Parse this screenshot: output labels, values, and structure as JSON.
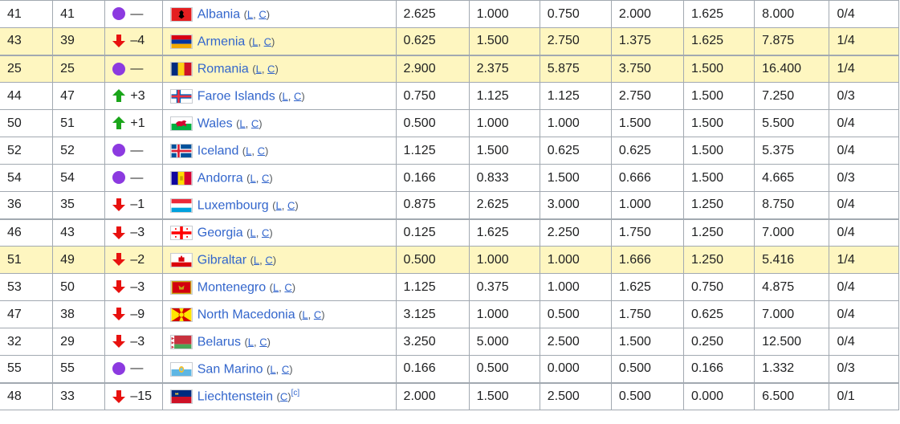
{
  "colors": {
    "highlight_row": "#fef6c0",
    "link": "#3366cc",
    "border": "#a2a9b1",
    "up": "#1aa51a",
    "down": "#e8110f",
    "steady": "#8c3ae0"
  },
  "rows": [
    {
      "a": "41",
      "b": "41",
      "move": "steady",
      "change": "—",
      "flag": "albania-flag-icon",
      "country": "Albania",
      "lc_open": "(",
      "l": "L",
      "comma": ", ",
      "c": "C",
      "lc_close": ")",
      "note": "",
      "v1": "2.625",
      "v2": "1.000",
      "v3": "0.750",
      "v4": "2.000",
      "v5": "1.625",
      "tot": "8.000",
      "frac": "0/4",
      "hl": false,
      "sep": false
    },
    {
      "a": "43",
      "b": "39",
      "move": "down",
      "change": "–4",
      "flag": "armenia-flag-icon",
      "country": "Armenia",
      "lc_open": "(",
      "l": "L",
      "comma": ", ",
      "c": "C",
      "lc_close": ")",
      "note": "",
      "v1": "0.625",
      "v2": "1.500",
      "v3": "2.750",
      "v4": "1.375",
      "v5": "1.625",
      "tot": "7.875",
      "frac": "1/4",
      "hl": true,
      "sep": false
    },
    {
      "a": "25",
      "b": "25",
      "move": "steady",
      "change": "—",
      "flag": "romania-flag-icon",
      "country": "Romania",
      "lc_open": "(",
      "l": "L",
      "comma": ", ",
      "c": "C",
      "lc_close": ")",
      "note": "",
      "v1": "2.900",
      "v2": "2.375",
      "v3": "5.875",
      "v4": "3.750",
      "v5": "1.500",
      "tot": "16.400",
      "frac": "1/4",
      "hl": true,
      "sep": true
    },
    {
      "a": "44",
      "b": "47",
      "move": "up",
      "change": "+3",
      "flag": "faroe-islands-flag-icon",
      "country": "Faroe Islands",
      "lc_open": "(",
      "l": "L",
      "comma": ", ",
      "c": "C",
      "lc_close": ")",
      "note": "",
      "v1": "0.750",
      "v2": "1.125",
      "v3": "1.125",
      "v4": "2.750",
      "v5": "1.500",
      "tot": "7.250",
      "frac": "0/3",
      "hl": false,
      "sep": false
    },
    {
      "a": "50",
      "b": "51",
      "move": "up",
      "change": "+1",
      "flag": "wales-flag-icon",
      "country": "Wales",
      "lc_open": "(",
      "l": "L",
      "comma": ", ",
      "c": "C",
      "lc_close": ")",
      "note": "",
      "v1": "0.500",
      "v2": "1.000",
      "v3": "1.000",
      "v4": "1.500",
      "v5": "1.500",
      "tot": "5.500",
      "frac": "0/4",
      "hl": false,
      "sep": false
    },
    {
      "a": "52",
      "b": "52",
      "move": "steady",
      "change": "—",
      "flag": "iceland-flag-icon",
      "country": "Iceland",
      "lc_open": "(",
      "l": "L",
      "comma": ", ",
      "c": "C",
      "lc_close": ")",
      "note": "",
      "v1": "1.125",
      "v2": "1.500",
      "v3": "0.625",
      "v4": "0.625",
      "v5": "1.500",
      "tot": "5.375",
      "frac": "0/4",
      "hl": false,
      "sep": false
    },
    {
      "a": "54",
      "b": "54",
      "move": "steady",
      "change": "—",
      "flag": "andorra-flag-icon",
      "country": "Andorra",
      "lc_open": "(",
      "l": "L",
      "comma": ", ",
      "c": "C",
      "lc_close": ")",
      "note": "",
      "v1": "0.166",
      "v2": "0.833",
      "v3": "1.500",
      "v4": "0.666",
      "v5": "1.500",
      "tot": "4.665",
      "frac": "0/3",
      "hl": false,
      "sep": false
    },
    {
      "a": "36",
      "b": "35",
      "move": "down",
      "change": "–1",
      "flag": "luxembourg-flag-icon",
      "country": "Luxembourg",
      "lc_open": "(",
      "l": "L",
      "comma": ", ",
      "c": "C",
      "lc_close": ")",
      "note": "",
      "v1": "0.875",
      "v2": "2.625",
      "v3": "3.000",
      "v4": "1.000",
      "v5": "1.250",
      "tot": "8.750",
      "frac": "0/4",
      "hl": false,
      "sep": false
    },
    {
      "a": "46",
      "b": "43",
      "move": "down",
      "change": "–3",
      "flag": "georgia-flag-icon",
      "country": "Georgia",
      "lc_open": "(",
      "l": "L",
      "comma": ", ",
      "c": "C",
      "lc_close": ")",
      "note": "",
      "v1": "0.125",
      "v2": "1.625",
      "v3": "2.250",
      "v4": "1.750",
      "v5": "1.250",
      "tot": "7.000",
      "frac": "0/4",
      "hl": false,
      "sep": true
    },
    {
      "a": "51",
      "b": "49",
      "move": "down",
      "change": "–2",
      "flag": "gibraltar-flag-icon",
      "country": "Gibraltar",
      "lc_open": "(",
      "l": "L",
      "comma": ", ",
      "c": "C",
      "lc_close": ")",
      "note": "",
      "v1": "0.500",
      "v2": "1.000",
      "v3": "1.000",
      "v4": "1.666",
      "v5": "1.250",
      "tot": "5.416",
      "frac": "1/4",
      "hl": true,
      "sep": false
    },
    {
      "a": "53",
      "b": "50",
      "move": "down",
      "change": "–3",
      "flag": "montenegro-flag-icon",
      "country": "Montenegro",
      "lc_open": "(",
      "l": "L",
      "comma": ", ",
      "c": "C",
      "lc_close": ")",
      "note": "",
      "v1": "1.125",
      "v2": "0.375",
      "v3": "1.000",
      "v4": "1.625",
      "v5": "0.750",
      "tot": "4.875",
      "frac": "0/4",
      "hl": false,
      "sep": false
    },
    {
      "a": "47",
      "b": "38",
      "move": "down",
      "change": "–9",
      "flag": "north-macedonia-flag-icon",
      "country": "North Macedonia",
      "lc_open": "(",
      "l": "L",
      "comma": ", ",
      "c": "C",
      "lc_close": ")",
      "note": "",
      "v1": "3.125",
      "v2": "1.000",
      "v3": "0.500",
      "v4": "1.750",
      "v5": "0.625",
      "tot": "7.000",
      "frac": "0/4",
      "hl": false,
      "sep": false
    },
    {
      "a": "32",
      "b": "29",
      "move": "down",
      "change": "–3",
      "flag": "belarus-flag-icon",
      "country": "Belarus",
      "lc_open": "(",
      "l": "L",
      "comma": ", ",
      "c": "C",
      "lc_close": ")",
      "note": "",
      "v1": "3.250",
      "v2": "5.000",
      "v3": "2.500",
      "v4": "1.500",
      "v5": "0.250",
      "tot": "12.500",
      "frac": "0/4",
      "hl": false,
      "sep": false
    },
    {
      "a": "55",
      "b": "55",
      "move": "steady",
      "change": "—",
      "flag": "san-marino-flag-icon",
      "country": "San Marino",
      "lc_open": "(",
      "l": "L",
      "comma": ", ",
      "c": "C",
      "lc_close": ")",
      "note": "",
      "v1": "0.166",
      "v2": "0.500",
      "v3": "0.000",
      "v4": "0.500",
      "v5": "0.166",
      "tot": "1.332",
      "frac": "0/3",
      "hl": false,
      "sep": false
    },
    {
      "a": "48",
      "b": "33",
      "move": "down",
      "change": "–15",
      "flag": "liechtenstein-flag-icon",
      "country": "Liechtenstein",
      "lc_open": "(",
      "l": "",
      "comma": "",
      "c": "C",
      "lc_close": ")",
      "note": "[c]",
      "v1": "2.000",
      "v2": "1.500",
      "v3": "2.500",
      "v4": "0.500",
      "v5": "0.000",
      "tot": "6.500",
      "frac": "0/1",
      "hl": false,
      "sep": true
    }
  ]
}
